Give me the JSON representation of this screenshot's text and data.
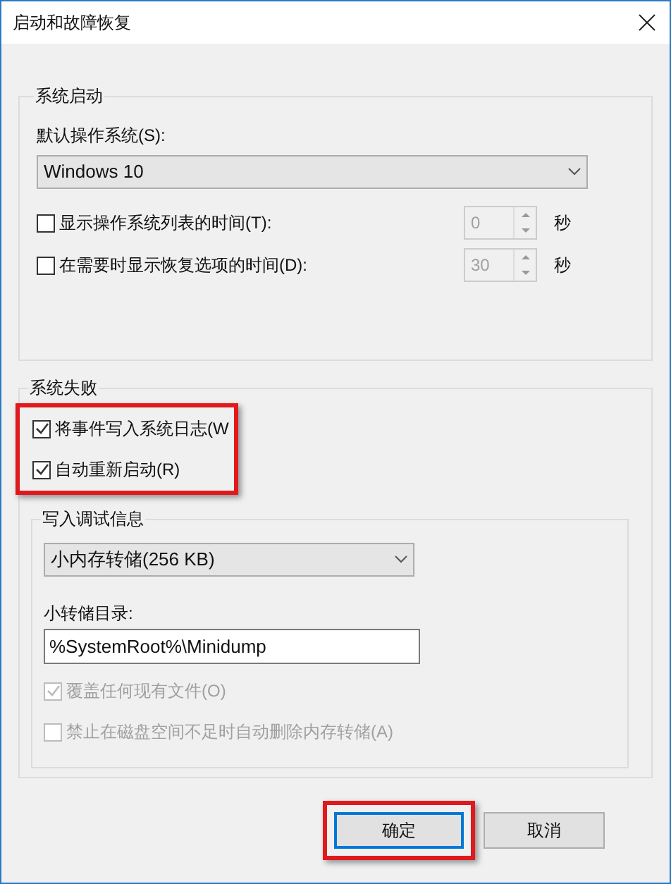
{
  "window": {
    "title": "启动和故障恢复"
  },
  "startup": {
    "title": "系统启动",
    "default_os_label": "默认操作系统(S):",
    "default_os": "Windows 10",
    "options": [
      {
        "label": "显示操作系统列表的时间(T):",
        "checked": false,
        "value": "0",
        "unit": "秒"
      },
      {
        "label": "在需要时显示恢复选项的时间(D):",
        "checked": false,
        "value": "30",
        "unit": "秒"
      }
    ]
  },
  "failure": {
    "title": "系统失败",
    "highlighted": true,
    "options": [
      {
        "label": "将事件写入系统日志(W",
        "checked": true
      },
      {
        "label": "自动重新启动(R)",
        "checked": true
      }
    ],
    "debug": {
      "title": "写入调试信息",
      "dump_type": "小内存转储(256 KB)",
      "dir_label": "小转储目录:",
      "dir": "%SystemRoot%\\Minidump",
      "options": [
        {
          "label": "覆盖任何现有文件(O)",
          "checked": true,
          "disabled": true
        },
        {
          "label": "禁止在磁盘空间不足时自动删除内存转储(A)",
          "checked": false,
          "disabled": true
        }
      ]
    }
  },
  "buttons": [
    {
      "label": "确定",
      "default": true,
      "highlighted": true
    },
    {
      "label": "取消",
      "default": false,
      "highlighted": false
    }
  ]
}
